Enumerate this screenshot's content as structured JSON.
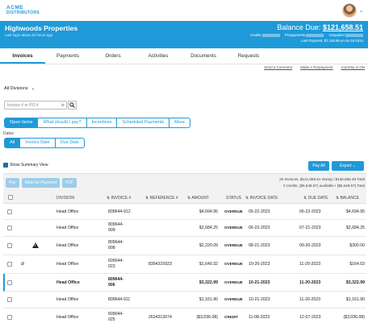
{
  "brand": {
    "line1": "ACME",
    "line2": "DISTRIBUTORS"
  },
  "account": {
    "name": "Highwoods Properties",
    "subtitle": "Last login about 23 hours ago",
    "balance_label": "Balance Due: ",
    "balance_value": "$121,658.51",
    "credits_label": "Credits",
    "prepayments_label": "Prepayments",
    "unapplied_label": "Unapplied",
    "last_payment": "Last Payment: $7,140.95 on 04-18-2024"
  },
  "tabs": [
    "Invoices",
    "Payments",
    "Orders",
    "Activities",
    "Documents",
    "Requests"
  ],
  "links": [
    "Send a Comment",
    "Make A Prepayment",
    "AutoPay is ON"
  ],
  "divisions": {
    "selected": "All Divisions"
  },
  "search": {
    "placeholder": "Invoice # or PO #"
  },
  "filters": [
    "Open Items",
    "What should I pay?",
    "Incentives",
    "Scheduled Payments",
    "More"
  ],
  "dates_label": "Dates",
  "date_filters": [
    "All",
    "Invoice Date",
    "Due Date"
  ],
  "summary_view": "Show Summary View",
  "pay_all": "Pay All",
  "export": "Export",
  "table_buttons": [
    "Pay",
    "Mark for Payment",
    "PDF"
  ],
  "summary_line1": "26 Invoices, $121,658.51 Owing / $136,665.48 Total",
  "summary_line2": "2 credits, ($5,648.57) available / ($5,648.57) Total",
  "columns": [
    "DIVISION",
    "INVOICE #",
    "REFERENCE #",
    "AMOUNT",
    "STATUS",
    "INVOICE DATE",
    "DUE DATE",
    "BALANCE"
  ],
  "rows": [
    {
      "division": "Head Office",
      "invoice": "809644-912",
      "ref": "",
      "amount": "$4,694.95",
      "status": "OVERDUE",
      "inv_date": "05-22-2023",
      "due": "06-22-2023",
      "balance": "$4,694.95"
    },
    {
      "division": "Head Office",
      "invoice": "809644-\n909",
      "ref": "",
      "amount": "$2,684.25",
      "status": "OVERDUE",
      "inv_date": "06-22-2023",
      "due": "07-21-2023",
      "balance": "$2,684.25"
    },
    {
      "division": "Head Office",
      "invoice": "809644-\n908",
      "ref": "",
      "amount": "$2,220.09",
      "status": "OVERDUE",
      "inv_date": "08-21-2023",
      "due": "09-20-2023",
      "balance": "$300.00"
    },
    {
      "division": "Head Office",
      "invoice": "609044-\n023",
      "ref": "8354315923",
      "amount": "$1,640.32",
      "status": "OVERDUE",
      "inv_date": "10-20-2023",
      "due": "11-20-2023",
      "balance": "$164.03"
    },
    {
      "division": "Head Office",
      "invoice": "809644-\n906",
      "ref": "",
      "amount": "$3,322.99",
      "status": "OVERDUE",
      "inv_date": "10-21-2023",
      "due": "11-20-2023",
      "balance": "$3,322.99"
    },
    {
      "division": "Head Office",
      "invoice": "809644-911",
      "ref": "",
      "amount": "$1,161.90",
      "status": "OVERDUE",
      "inv_date": "10-21-2023",
      "due": "11-20-2023",
      "balance": "$1,161.90"
    },
    {
      "division": "Head Office",
      "invoice": "609044-\n025",
      "ref": "2624313074",
      "amount": "($3,036.08)",
      "status": "CREDIT",
      "inv_date": "11-08-2023",
      "due": "12-07-2023",
      "balance": "($3,036.08)"
    }
  ]
}
